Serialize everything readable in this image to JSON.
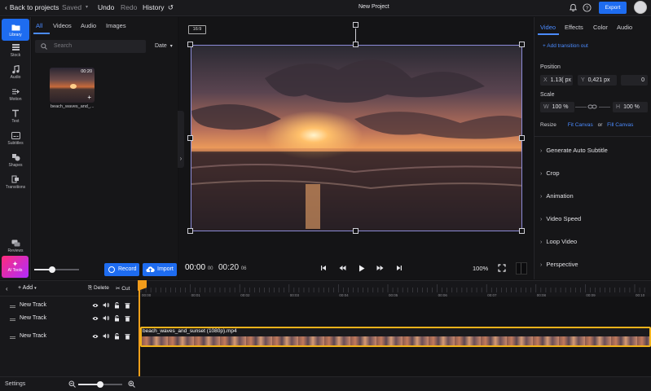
{
  "topbar": {
    "back_label": "Back to projects",
    "saved_label": "Saved",
    "undo_label": "Undo",
    "redo_label": "Redo",
    "history_label": "History",
    "project_title": "New Project",
    "export_label": "Export"
  },
  "rail": {
    "items": [
      {
        "label": "Library",
        "icon": "folder-icon"
      },
      {
        "label": "Stock",
        "icon": "stock-icon"
      },
      {
        "label": "Audio",
        "icon": "music-note-icon"
      },
      {
        "label": "Motion",
        "icon": "motion-icon"
      },
      {
        "label": "Text",
        "icon": "text-icon"
      },
      {
        "label": "Subtitles",
        "icon": "subtitles-icon"
      },
      {
        "label": "Shapes",
        "icon": "shapes-icon"
      },
      {
        "label": "Transitions",
        "icon": "transitions-icon"
      }
    ],
    "reviews_label": "Reviews",
    "ai_tools_label": "AI Tools"
  },
  "library": {
    "tabs": [
      "All",
      "Videos",
      "Audio",
      "Images"
    ],
    "search_placeholder": "Search",
    "sort_label": "Date",
    "media": [
      {
        "name": "beach_waves_and_...",
        "duration": "00:20"
      }
    ],
    "record_label": "Record",
    "import_label": "Import",
    "zoom_slider_value": 0.4
  },
  "preview": {
    "aspect_label": "16:9",
    "current_time": "00:00",
    "current_frames": "00",
    "end_time": "00:20",
    "end_frames": "06",
    "zoom_label": "100%"
  },
  "properties": {
    "tabs": [
      "Video",
      "Effects",
      "Color",
      "Audio"
    ],
    "add_transition_label": "Add transition out",
    "position_label": "Position",
    "position": {
      "x_prefix": "X",
      "x": "1.13( px",
      "y_prefix": "Y",
      "y": "0,421 px",
      "r": "0"
    },
    "scale_label": "Scale",
    "scale": {
      "w_prefix": "W",
      "w": "100 %",
      "h_prefix": "H",
      "h": "100 %"
    },
    "resize_label": "Resize",
    "fit_canvas_label": "Fit Canvas",
    "or_label": "or",
    "fill_canvas_label": "Fill Canvas",
    "sections": [
      "Generate Auto Subtitle",
      "Crop",
      "Animation",
      "Video Speed",
      "Loop Video",
      "Perspective"
    ]
  },
  "timeline": {
    "add_label": "Add",
    "delete_label": "Delete",
    "cut_label": "Cut",
    "tracks": [
      {
        "name": "New Track"
      },
      {
        "name": "New Track"
      },
      {
        "name": "New Track"
      }
    ],
    "ruler_labels": [
      "00:00",
      "00:01",
      "00:02",
      "00:03",
      "00:04",
      "00:05",
      "00:06",
      "00:07",
      "00:08",
      "00:09",
      "00:10"
    ],
    "clip_name": "beach_waves_and_sunset (1080p).mp4"
  },
  "footer": {
    "settings_label": "Settings",
    "zoom_value": 0.5
  },
  "colors": {
    "accent": "#1e6cf0",
    "link": "#4b8bff",
    "playhead": "#f2a01b",
    "clip_border": "#f2b21b"
  }
}
